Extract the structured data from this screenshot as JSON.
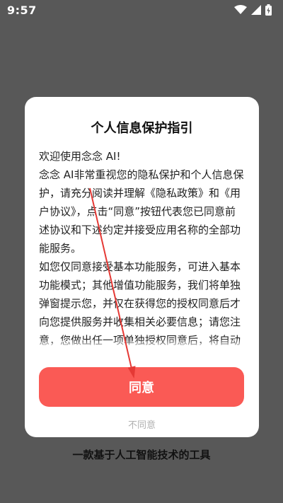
{
  "status_bar": {
    "time": "9:57",
    "icons": [
      "wifi-icon",
      "cellular-signal-icon",
      "battery-charging-icon"
    ]
  },
  "dialog": {
    "title": "个人信息保护指引",
    "paragraphs": [
      "欢迎使用念念 AI!",
      "念念 AI非常重视您的隐私保护和个人信息保护，请充分阅读并理解《隐私政策》和《用户协议》，点击“同意”按钮代表您已同意前述协议和下述约定并接受应用名称的全部功能服务。",
      "如您仅同意接受基本功能服务，可进入基本功能模式；其他增值功能服务，我们将单独弹窗提示您，并仅在获得您的授权同意后才向您提供服务并收集相关必要信息；请您注意，您做出任一项单独授权同意后，将自动退出基本功能模式。"
    ],
    "agree_label": "同意",
    "disagree_label": "不同意"
  },
  "footer": {
    "slogan": "一款基于人工智能技术的工具"
  },
  "colors": {
    "backdrop": "#585858",
    "accent": "#fa5a55",
    "annotation_arrow": "#e53935",
    "muted_text": "#b0b0b0"
  }
}
